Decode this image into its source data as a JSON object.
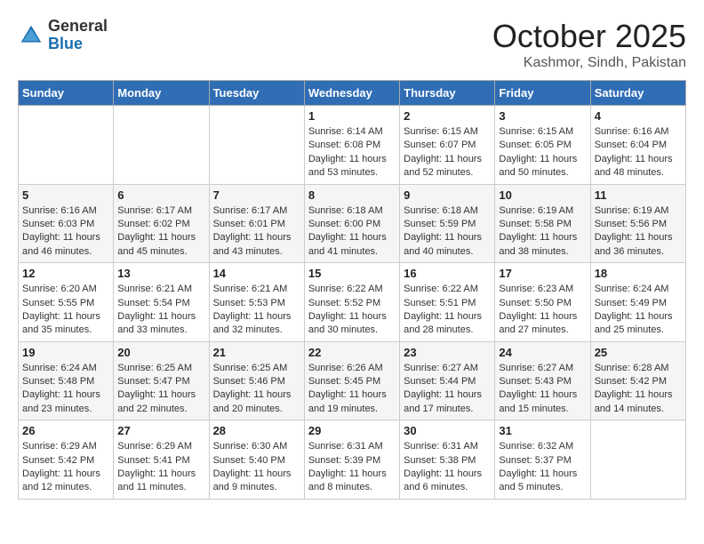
{
  "header": {
    "logo_general": "General",
    "logo_blue": "Blue",
    "month": "October 2025",
    "location": "Kashmor, Sindh, Pakistan"
  },
  "days_of_week": [
    "Sunday",
    "Monday",
    "Tuesday",
    "Wednesday",
    "Thursday",
    "Friday",
    "Saturday"
  ],
  "weeks": [
    [
      {
        "day": "",
        "info": ""
      },
      {
        "day": "",
        "info": ""
      },
      {
        "day": "",
        "info": ""
      },
      {
        "day": "1",
        "info": "Sunrise: 6:14 AM\nSunset: 6:08 PM\nDaylight: 11 hours and 53 minutes."
      },
      {
        "day": "2",
        "info": "Sunrise: 6:15 AM\nSunset: 6:07 PM\nDaylight: 11 hours and 52 minutes."
      },
      {
        "day": "3",
        "info": "Sunrise: 6:15 AM\nSunset: 6:05 PM\nDaylight: 11 hours and 50 minutes."
      },
      {
        "day": "4",
        "info": "Sunrise: 6:16 AM\nSunset: 6:04 PM\nDaylight: 11 hours and 48 minutes."
      }
    ],
    [
      {
        "day": "5",
        "info": "Sunrise: 6:16 AM\nSunset: 6:03 PM\nDaylight: 11 hours and 46 minutes."
      },
      {
        "day": "6",
        "info": "Sunrise: 6:17 AM\nSunset: 6:02 PM\nDaylight: 11 hours and 45 minutes."
      },
      {
        "day": "7",
        "info": "Sunrise: 6:17 AM\nSunset: 6:01 PM\nDaylight: 11 hours and 43 minutes."
      },
      {
        "day": "8",
        "info": "Sunrise: 6:18 AM\nSunset: 6:00 PM\nDaylight: 11 hours and 41 minutes."
      },
      {
        "day": "9",
        "info": "Sunrise: 6:18 AM\nSunset: 5:59 PM\nDaylight: 11 hours and 40 minutes."
      },
      {
        "day": "10",
        "info": "Sunrise: 6:19 AM\nSunset: 5:58 PM\nDaylight: 11 hours and 38 minutes."
      },
      {
        "day": "11",
        "info": "Sunrise: 6:19 AM\nSunset: 5:56 PM\nDaylight: 11 hours and 36 minutes."
      }
    ],
    [
      {
        "day": "12",
        "info": "Sunrise: 6:20 AM\nSunset: 5:55 PM\nDaylight: 11 hours and 35 minutes."
      },
      {
        "day": "13",
        "info": "Sunrise: 6:21 AM\nSunset: 5:54 PM\nDaylight: 11 hours and 33 minutes."
      },
      {
        "day": "14",
        "info": "Sunrise: 6:21 AM\nSunset: 5:53 PM\nDaylight: 11 hours and 32 minutes."
      },
      {
        "day": "15",
        "info": "Sunrise: 6:22 AM\nSunset: 5:52 PM\nDaylight: 11 hours and 30 minutes."
      },
      {
        "day": "16",
        "info": "Sunrise: 6:22 AM\nSunset: 5:51 PM\nDaylight: 11 hours and 28 minutes."
      },
      {
        "day": "17",
        "info": "Sunrise: 6:23 AM\nSunset: 5:50 PM\nDaylight: 11 hours and 27 minutes."
      },
      {
        "day": "18",
        "info": "Sunrise: 6:24 AM\nSunset: 5:49 PM\nDaylight: 11 hours and 25 minutes."
      }
    ],
    [
      {
        "day": "19",
        "info": "Sunrise: 6:24 AM\nSunset: 5:48 PM\nDaylight: 11 hours and 23 minutes."
      },
      {
        "day": "20",
        "info": "Sunrise: 6:25 AM\nSunset: 5:47 PM\nDaylight: 11 hours and 22 minutes."
      },
      {
        "day": "21",
        "info": "Sunrise: 6:25 AM\nSunset: 5:46 PM\nDaylight: 11 hours and 20 minutes."
      },
      {
        "day": "22",
        "info": "Sunrise: 6:26 AM\nSunset: 5:45 PM\nDaylight: 11 hours and 19 minutes."
      },
      {
        "day": "23",
        "info": "Sunrise: 6:27 AM\nSunset: 5:44 PM\nDaylight: 11 hours and 17 minutes."
      },
      {
        "day": "24",
        "info": "Sunrise: 6:27 AM\nSunset: 5:43 PM\nDaylight: 11 hours and 15 minutes."
      },
      {
        "day": "25",
        "info": "Sunrise: 6:28 AM\nSunset: 5:42 PM\nDaylight: 11 hours and 14 minutes."
      }
    ],
    [
      {
        "day": "26",
        "info": "Sunrise: 6:29 AM\nSunset: 5:42 PM\nDaylight: 11 hours and 12 minutes."
      },
      {
        "day": "27",
        "info": "Sunrise: 6:29 AM\nSunset: 5:41 PM\nDaylight: 11 hours and 11 minutes."
      },
      {
        "day": "28",
        "info": "Sunrise: 6:30 AM\nSunset: 5:40 PM\nDaylight: 11 hours and 9 minutes."
      },
      {
        "day": "29",
        "info": "Sunrise: 6:31 AM\nSunset: 5:39 PM\nDaylight: 11 hours and 8 minutes."
      },
      {
        "day": "30",
        "info": "Sunrise: 6:31 AM\nSunset: 5:38 PM\nDaylight: 11 hours and 6 minutes."
      },
      {
        "day": "31",
        "info": "Sunrise: 6:32 AM\nSunset: 5:37 PM\nDaylight: 11 hours and 5 minutes."
      },
      {
        "day": "",
        "info": ""
      }
    ]
  ]
}
